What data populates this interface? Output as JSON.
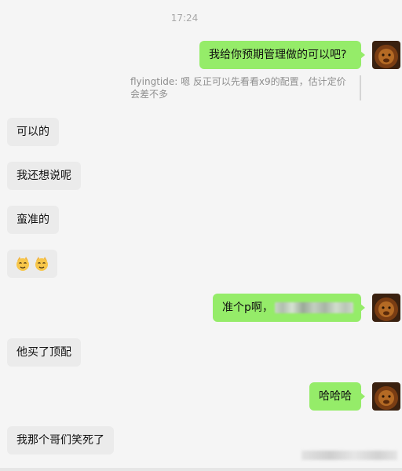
{
  "chat": {
    "timestamp": "17:24",
    "messages": [
      {
        "side": "out",
        "text": "我给你预期管理做的可以吧?"
      },
      {
        "side": "quote",
        "text": "flyingtide: 嗯 反正可以先看看x9的配置，估计定价会差不多"
      },
      {
        "side": "in",
        "text": "可以的"
      },
      {
        "side": "in",
        "text": "我还想说呢"
      },
      {
        "side": "in",
        "text": "蛮准的"
      },
      {
        "side": "in",
        "emoji": [
          "cat-emoji",
          "cat-emoji"
        ]
      },
      {
        "side": "out",
        "text": "准个p啊，"
      },
      {
        "side": "in",
        "text": "他买了顶配"
      },
      {
        "side": "out",
        "text": "哈哈哈"
      },
      {
        "side": "in",
        "text": "我那个哥们笑死了"
      }
    ]
  },
  "colors": {
    "background": "#f5f5f5",
    "incoming_bubble": "#ebebeb",
    "outgoing_bubble": "#95ec69",
    "quote_text": "#8e8e8e",
    "timestamp_text": "#a8a8a8"
  },
  "avatar_icon": "lion-avatar-icon"
}
